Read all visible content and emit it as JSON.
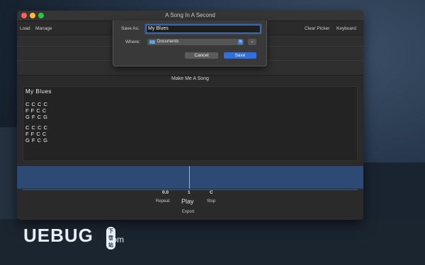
{
  "window": {
    "title": "A Song In A Second"
  },
  "toolbar": {
    "left": [
      "Load",
      "Manage"
    ],
    "right": [
      "Clear Picker",
      "Keyboard"
    ]
  },
  "save_sheet": {
    "save_as_label": "Save As:",
    "filename": "My Blues",
    "where_label": "Where:",
    "location": "Documents",
    "cancel_label": "Cancel",
    "save_label": "Save"
  },
  "make_song": {
    "title": "Make Me A Song"
  },
  "song": {
    "title": "My Blues",
    "lines": [
      "C C C C",
      "F F C C",
      "G F C G",
      "C C C C",
      "F F C C",
      "G F C G"
    ]
  },
  "controls": {
    "values": {
      "repeat": "0.0",
      "play": "1",
      "stop": "C"
    },
    "labels": {
      "repeat": "Repeat",
      "play": "Play",
      "stop": "Stop",
      "export": "Export"
    }
  },
  "watermark": {
    "brand": "UEBUG",
    "tag": "下载站",
    "suffix": ".com"
  }
}
